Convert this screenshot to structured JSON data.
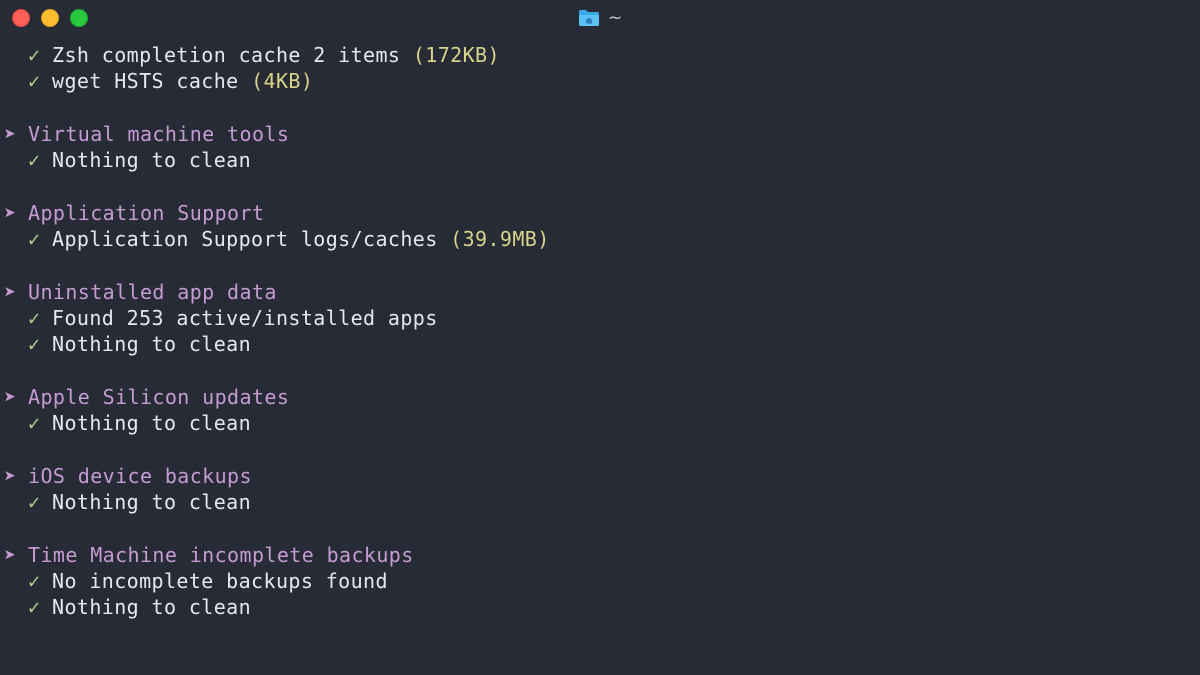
{
  "window": {
    "title": "~",
    "icon": "folder-icon"
  },
  "terminal": {
    "glyphs": {
      "check": "✓",
      "arrow": "➤"
    },
    "colors": {
      "background": "#272b35",
      "text": "#e6e8ee",
      "section": "#c49bd3",
      "check": "#b6d08b",
      "size": "#d8d38a"
    },
    "top_items": [
      {
        "text": "Zsh completion cache 2 items",
        "size": "(172KB)"
      },
      {
        "text": "wget HSTS cache",
        "size": "(4KB)"
      }
    ],
    "sections": [
      {
        "title": "Virtual machine tools",
        "items": [
          {
            "text": "Nothing to clean"
          }
        ]
      },
      {
        "title": "Application Support",
        "items": [
          {
            "text": "Application Support logs/caches",
            "size": "(39.9MB)"
          }
        ]
      },
      {
        "title": "Uninstalled app data",
        "items": [
          {
            "text": "Found 253 active/installed apps"
          },
          {
            "text": "Nothing to clean"
          }
        ]
      },
      {
        "title": "Apple Silicon updates",
        "items": [
          {
            "text": "Nothing to clean"
          }
        ]
      },
      {
        "title": "iOS device backups",
        "items": [
          {
            "text": "Nothing to clean"
          }
        ]
      },
      {
        "title": "Time Machine incomplete backups",
        "items": [
          {
            "text": "No incomplete backups found"
          },
          {
            "text": "Nothing to clean"
          }
        ]
      }
    ]
  }
}
